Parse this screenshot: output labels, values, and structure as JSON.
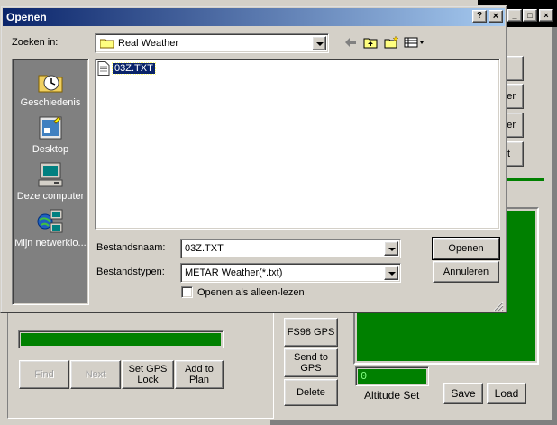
{
  "background_window": {
    "buttons": {
      "find": "Find",
      "next": "Next",
      "set_gps_lock": "Set GPS Lock",
      "add_to_plan": "Add to Plan",
      "fs98_gps": "FS98 GPS",
      "send_to_gps": "Send to GPS",
      "delete": "Delete",
      "save": "Save",
      "load": "Load",
      "partial_1": "er",
      "partial_2": "er",
      "partial_3": "t"
    },
    "altitude_value": "0",
    "altitude_label": "Altitude Set",
    "titlebar_controls": [
      "_",
      "□",
      "×"
    ]
  },
  "dialog": {
    "title": "Openen",
    "title_buttons": [
      "?",
      "×"
    ],
    "look_in_label": "Zoeken in:",
    "look_in_value": "Real Weather",
    "places": [
      {
        "label": "Geschiedenis",
        "icon": "history-icon"
      },
      {
        "label": "Desktop",
        "icon": "desktop-icon"
      },
      {
        "label": "Deze computer",
        "icon": "my-computer-icon"
      },
      {
        "label": "Mijn netwerklo...",
        "icon": "network-places-icon"
      }
    ],
    "files": [
      {
        "name": "03Z.TXT",
        "selected": true
      }
    ],
    "filename_label": "Bestandsnaam:",
    "filename_value": "03Z.TXT",
    "filetype_label": "Bestandstypen:",
    "filetype_value": "METAR Weather(*.txt)",
    "readonly_label": "Openen als alleen-lezen",
    "readonly_checked": false,
    "open_button": "Openen",
    "cancel_button": "Annuleren"
  },
  "colors": {
    "titlebar_start": "#0a246a",
    "titlebar_end": "#a6caf0",
    "accent_green": "#008000",
    "places_bg": "#808080",
    "selection": "#0a246a"
  }
}
